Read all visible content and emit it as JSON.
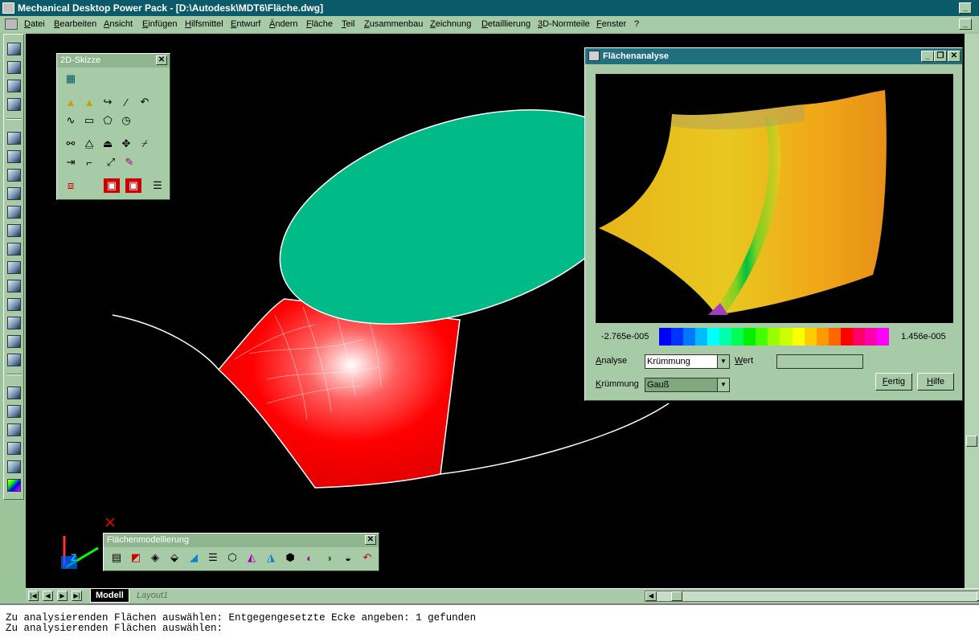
{
  "window": {
    "title": "Mechanical Desktop Power Pack - [D:\\Autodesk\\MDT6\\Fläche.dwg]",
    "minimize": "_",
    "restore": "❐",
    "close": "✕"
  },
  "menu": [
    "Datei",
    "Bearbeiten",
    "Ansicht",
    "Einfügen",
    "Hilfsmittel",
    "Entwurf",
    "Ändern",
    "Fläche",
    "Teil",
    "Zusammenbau",
    "Zeichnung",
    "Detaillierung",
    "3D-Normteile",
    "Fenster",
    "?"
  ],
  "sketch_toolbar": {
    "title": "2D-Skizze",
    "close": "✕"
  },
  "surface_toolbar": {
    "title": "Flächenmodellierung",
    "close": "✕"
  },
  "analysis_dialog": {
    "title": "Flächenanalyse",
    "scale_min": "-2.765e-005",
    "scale_max": "1.456e-005",
    "analyse_label": "Analyse",
    "analyse_value": "Krümmung",
    "wert_label": "Wert",
    "wert_value": "",
    "kruemmung_label": "Krümmung",
    "kruemmung_value": "Gauß",
    "fertig_button": "Fertig",
    "hilfe_button": "Hilfe",
    "colors": [
      "#0000ff",
      "#0033ff",
      "#0077ff",
      "#00bbff",
      "#00ffff",
      "#00ffaa",
      "#00ff55",
      "#00ee00",
      "#44ff00",
      "#99ff00",
      "#ccff00",
      "#ffff00",
      "#ffcc00",
      "#ff9900",
      "#ff6600",
      "#ff0000",
      "#ff0066",
      "#ff00aa",
      "#ff00ff"
    ]
  },
  "tabs": {
    "model": "Modell",
    "layout": "Layout1"
  },
  "command_line": [
    "Zu analysierenden Flächen auswählen: Entgegengesetzte Ecke angeben: 1 gefunden",
    "Zu analysierenden Flächen auswählen:"
  ],
  "ucs": {
    "x_label": "X",
    "z_label": "Z"
  }
}
